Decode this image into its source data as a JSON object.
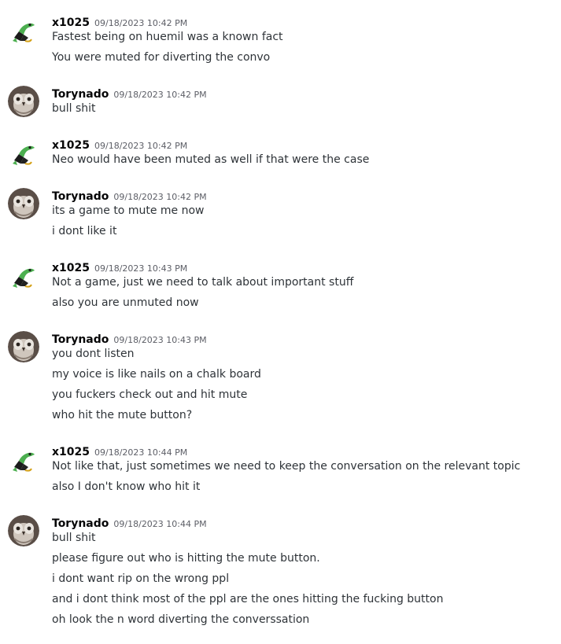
{
  "messages": [
    {
      "user": "x1025",
      "timestamp": "09/18/2023 10:42 PM",
      "avatar_icon": "gecko-avatar-icon",
      "lines": [
        "Fastest being on huemil was a known fact",
        "You were muted for diverting the convo"
      ]
    },
    {
      "user": "Torynado",
      "timestamp": "09/18/2023 10:42 PM",
      "avatar_icon": "owl-avatar-icon",
      "lines": [
        "bull shit"
      ]
    },
    {
      "user": "x1025",
      "timestamp": "09/18/2023 10:42 PM",
      "avatar_icon": "gecko-avatar-icon",
      "lines": [
        "Neo would have been muted as well if that were the case"
      ]
    },
    {
      "user": "Torynado",
      "timestamp": "09/18/2023 10:42 PM",
      "avatar_icon": "owl-avatar-icon",
      "lines": [
        "its a game to mute me now",
        "i dont like it"
      ]
    },
    {
      "user": "x1025",
      "timestamp": "09/18/2023 10:43 PM",
      "avatar_icon": "gecko-avatar-icon",
      "lines": [
        "Not a game, just we need to talk about important stuff",
        "also you are unmuted now"
      ]
    },
    {
      "user": "Torynado",
      "timestamp": "09/18/2023 10:43 PM",
      "avatar_icon": "owl-avatar-icon",
      "lines": [
        "you dont listen",
        "my voice is like nails on a chalk board",
        "you fuckers check out and hit mute",
        "who hit the mute button?"
      ]
    },
    {
      "user": "x1025",
      "timestamp": "09/18/2023 10:44 PM",
      "avatar_icon": "gecko-avatar-icon",
      "lines": [
        "Not like that, just sometimes we need to keep the conversation on the relevant topic",
        "also I don't know who hit it"
      ]
    },
    {
      "user": "Torynado",
      "timestamp": "09/18/2023 10:44 PM",
      "avatar_icon": "owl-avatar-icon",
      "lines": [
        "bull shit",
        "please figure out who is hitting the mute button.",
        "i dont want rip on the wrong ppl",
        "and i dont think most of the ppl are the ones hitting the fucking button",
        "oh look the n word diverting the converssation"
      ]
    }
  ],
  "colors": {
    "background": "#ffffff",
    "username": "#060607",
    "timestamp": "#5c5e66",
    "message_text": "#2e3338"
  }
}
